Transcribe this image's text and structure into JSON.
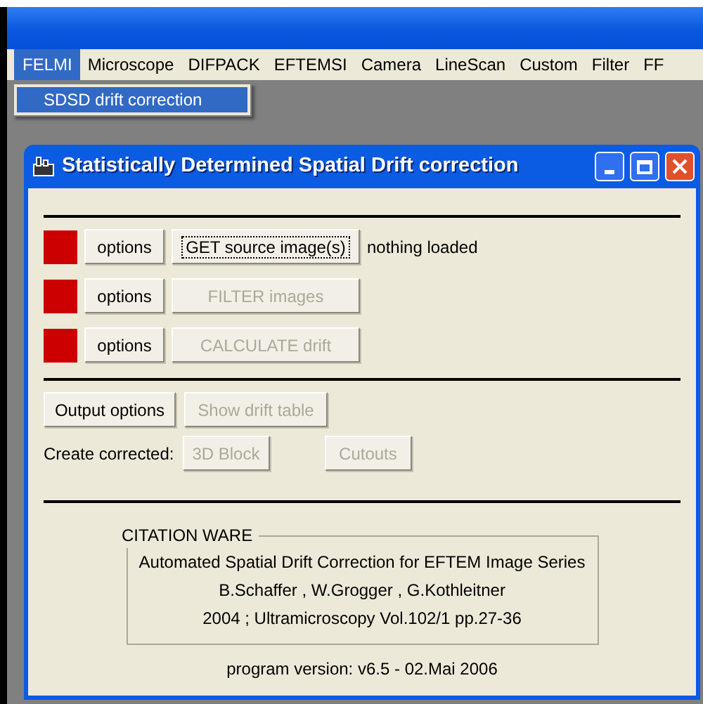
{
  "menu_bar": [
    {
      "label": "FELMI",
      "selected": true
    },
    {
      "label": "Microscope",
      "selected": false
    },
    {
      "label": "DIFPACK",
      "selected": false
    },
    {
      "label": "EFTEMSI",
      "selected": false
    },
    {
      "label": "Camera",
      "selected": false
    },
    {
      "label": "LineScan",
      "selected": false
    },
    {
      "label": "Custom",
      "selected": false
    },
    {
      "label": "Filter",
      "selected": false
    },
    {
      "label": "FF",
      "selected": false
    }
  ],
  "dropdown_menu": {
    "items": [
      {
        "label": "SDSD drift correction",
        "selected": true
      }
    ]
  },
  "dialog": {
    "title": "Statistically Determined Spatial Drift correction",
    "steps": [
      {
        "color": "#cc0000",
        "options_label": "options",
        "action": {
          "label": "GET source image(s)",
          "disabled": false,
          "focused": true
        },
        "status": "nothing loaded"
      },
      {
        "color": "#cc0000",
        "options_label": "options",
        "action": {
          "label": "FILTER images",
          "disabled": true,
          "focused": false
        }
      },
      {
        "color": "#cc0000",
        "options_label": "options",
        "action": {
          "label": "CALCULATE drift",
          "disabled": true,
          "focused": false
        }
      }
    ],
    "output_buttons": [
      {
        "label": "Output options",
        "disabled": false
      },
      {
        "label": "Show drift table",
        "disabled": true
      }
    ],
    "create_label": "Create corrected:",
    "create_buttons": [
      {
        "label": "3D Block",
        "disabled": true
      },
      {
        "label": "Cutouts",
        "disabled": true
      }
    ],
    "citation": {
      "legend": "CITATION WARE",
      "lines": [
        "Automated Spatial Drift Correction for EFTEM Image Series",
        "B.Schaffer , W.Grogger , G.Kothleitner",
        "2004 ; Ultramicroscopy Vol.102/1 pp.27-36"
      ]
    },
    "version": "program version: v6.5 - 02.Mai 2006"
  }
}
